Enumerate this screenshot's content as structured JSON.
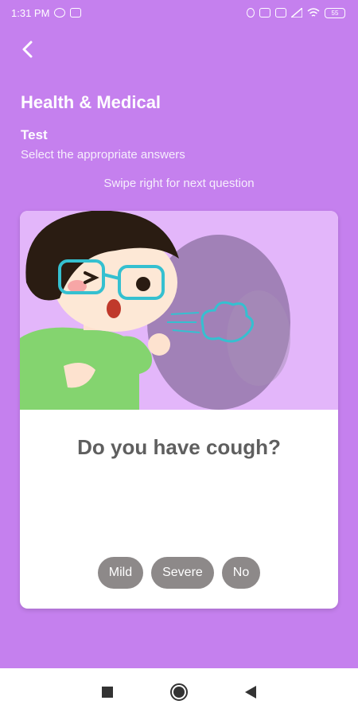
{
  "status_bar": {
    "time": "1:31 PM",
    "battery": "55",
    "icons": [
      "whatsapp-icon",
      "translate-icon",
      "bluetooth-icon",
      "vibrate-icon",
      "data-icon",
      "signal-icon",
      "wifi-icon",
      "battery-icon"
    ]
  },
  "header": {
    "back_icon": "chevron-left-icon",
    "title": "Health & Medical",
    "subtitle": "Test",
    "description": "Select the appropriate answers",
    "hint": "Swipe right for next question"
  },
  "card": {
    "question": "Do you have cough?",
    "answers": [
      "Mild",
      "Severe",
      "No"
    ]
  },
  "nav_bar": {
    "icons": [
      "recents-square-icon",
      "home-circle-icon",
      "back-triangle-icon"
    ]
  },
  "colors": {
    "background": "#c580ee",
    "illustration_bg": "#e3b6fa",
    "chip": "#8d8989",
    "question_text": "#5f5f5f"
  }
}
